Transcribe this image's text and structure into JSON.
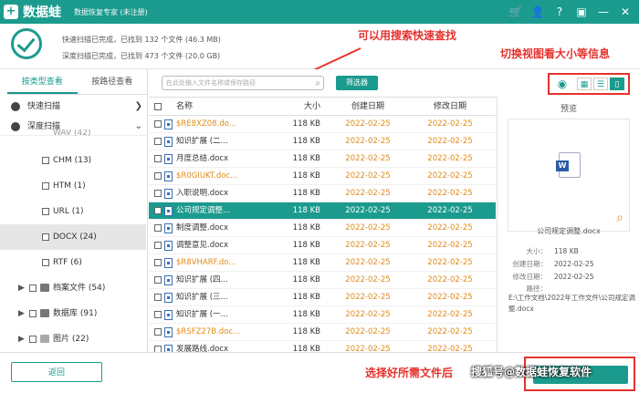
{
  "app": {
    "logo_mark": "+",
    "name": "数据蛙",
    "subtitle": "数据恢复专家 (未注册)"
  },
  "title_icons": [
    "cart-icon",
    "user-icon",
    "help-icon",
    "save-icon",
    "minimize-icon",
    "close-icon"
  ],
  "status": {
    "quick": "快速扫描已完成，已找到 132 个文件 (46.3 MB)",
    "deep": "深度扫描已完成，已找到 473 个文件 (20.0 GB)"
  },
  "annotations": {
    "search_tip": "可以用搜索快速查找",
    "view_tip": "切换视图看大小等信息",
    "select_tip": "选择好所需文件后"
  },
  "left": {
    "tabs": [
      "按类型查看",
      "按路径查看"
    ],
    "scans": [
      "快速扫描",
      "深度扫描"
    ],
    "partial_item": "WAV (42)",
    "types": [
      {
        "label": "CHM (13)"
      },
      {
        "label": "HTM (1)"
      },
      {
        "label": "URL (1)"
      },
      {
        "label": "DOCX (24)"
      },
      {
        "label": "RTF (6)"
      }
    ],
    "folders": [
      {
        "label": "档案文件 (54)"
      },
      {
        "label": "数据库 (91)"
      },
      {
        "label": "图片 (22)"
      }
    ]
  },
  "toolbar": {
    "search_placeholder": "在此处输入文件名称或保存路径",
    "filter_label": "筛选器"
  },
  "table": {
    "headers": {
      "name": "名称",
      "size": "大小",
      "created": "创建日期",
      "modified": "修改日期"
    },
    "rows": [
      {
        "name": "$RE8XZ08.do...",
        "size": "118 KB",
        "created": "2022-02-25",
        "modified": "2022-02-25",
        "orange": true
      },
      {
        "name": "知识扩展 (二...",
        "size": "118 KB",
        "created": "2022-02-25",
        "modified": "2022-02-25",
        "orange": false
      },
      {
        "name": "月度总结.docx",
        "size": "118 KB",
        "created": "2022-02-25",
        "modified": "2022-02-25",
        "orange": false
      },
      {
        "name": "$R0GIUKT.doc...",
        "size": "118 KB",
        "created": "2022-02-25",
        "modified": "2022-02-25",
        "orange": true
      },
      {
        "name": "入职说明.docx",
        "size": "118 KB",
        "created": "2022-02-25",
        "modified": "2022-02-25",
        "orange": false
      },
      {
        "name": "公司规定调整...",
        "size": "118 KB",
        "created": "2022-02-25",
        "modified": "2022-02-25",
        "orange": false
      },
      {
        "name": "制度调整.docx",
        "size": "118 KB",
        "created": "2022-02-25",
        "modified": "2022-02-25",
        "orange": false
      },
      {
        "name": "调整意见.docx",
        "size": "118 KB",
        "created": "2022-02-25",
        "modified": "2022-02-25",
        "orange": false
      },
      {
        "name": "$R8VHARF.do...",
        "size": "118 KB",
        "created": "2022-02-25",
        "modified": "2022-02-25",
        "orange": true
      },
      {
        "name": "知识扩展 (四...",
        "size": "118 KB",
        "created": "2022-02-25",
        "modified": "2022-02-25",
        "orange": false
      },
      {
        "name": "知识扩展 (三...",
        "size": "118 KB",
        "created": "2022-02-25",
        "modified": "2022-02-25",
        "orange": false
      },
      {
        "name": "知识扩展 (一...",
        "size": "118 KB",
        "created": "2022-02-25",
        "modified": "2022-02-25",
        "orange": false
      },
      {
        "name": "$RSFZ27B.doc...",
        "size": "118 KB",
        "created": "2022-02-25",
        "modified": "2022-02-25",
        "orange": true
      },
      {
        "name": "发展路线.docx",
        "size": "118 KB",
        "created": "2022-02-25",
        "modified": "2022-02-25",
        "orange": false
      }
    ]
  },
  "preview": {
    "title": "预览",
    "icon_letter": "W",
    "file_name": "公司规定调整.docx",
    "size_k": "大小：",
    "size_v": "118 KB",
    "created_k": "创建日期：",
    "created_v": "2022-02-25",
    "modified_k": "修改日期：",
    "modified_v": "2022-02-25",
    "path_k": "路径：",
    "path_v": "E:\\工作文档\\2022年工作文件\\公司规定调整.docx"
  },
  "bottom": {
    "back_label": "返回",
    "recover_label": "恢复",
    "watermark": "搜狐号@数据蛙恢复软件"
  },
  "colors": {
    "accent": "#1b9b8e",
    "annotation": "#e5322d",
    "orange": "#e08a1a"
  }
}
